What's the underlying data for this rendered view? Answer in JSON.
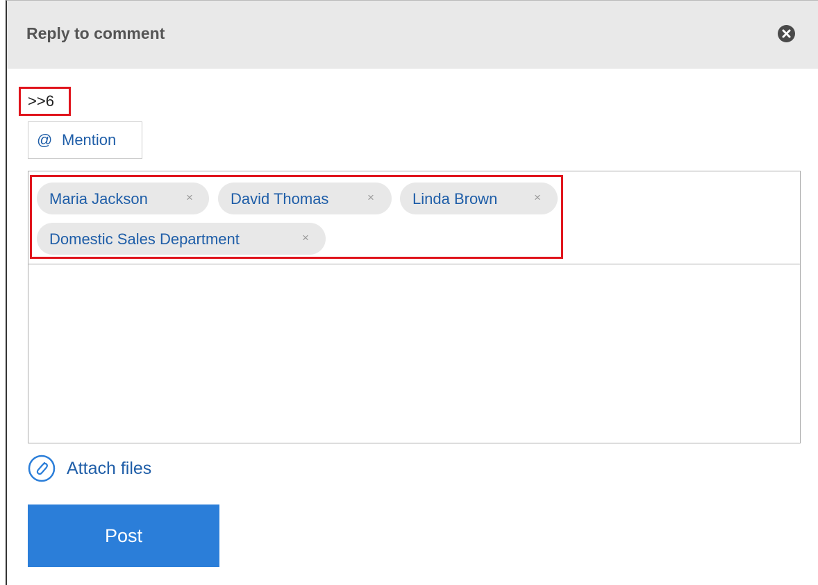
{
  "dialog": {
    "title": "Reply to comment",
    "close_icon": "close-icon"
  },
  "reply_reference": ">>6",
  "mention_button": {
    "at": "@",
    "label": "Mention"
  },
  "mentions": [
    {
      "label": "Maria Jackson",
      "remove": "×"
    },
    {
      "label": "David Thomas",
      "remove": "×"
    },
    {
      "label": "Linda Brown",
      "remove": "×"
    },
    {
      "label": "Domestic Sales Department",
      "remove": "×"
    }
  ],
  "attach": {
    "icon": "paperclip-icon",
    "label": "Attach files"
  },
  "post_button": {
    "label": "Post"
  },
  "colors": {
    "accent": "#2b7ed9",
    "link": "#1f5ea8",
    "highlight": "#e0141c",
    "header_bg": "#e9e9e9"
  }
}
